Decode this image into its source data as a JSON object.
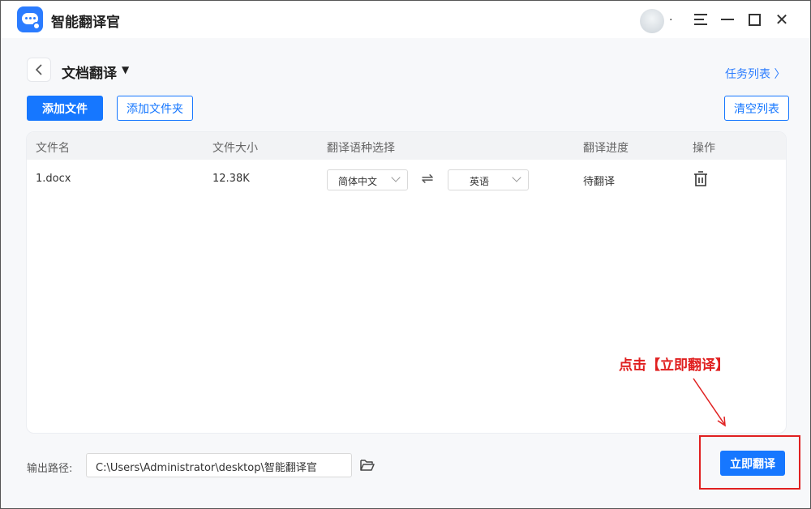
{
  "app": {
    "title": "智能翻译官",
    "avatar_suffix": ".",
    "window_controls": [
      "menu-icon",
      "minimize-icon",
      "maximize-icon",
      "close-icon"
    ]
  },
  "header": {
    "back_icon": "chevron-left-icon",
    "title": "文档翻译",
    "task_list_link": "任务列表 〉"
  },
  "toolbar": {
    "add_file": "添加文件",
    "add_folder": "添加文件夹",
    "clear_list": "清空列表"
  },
  "table": {
    "columns": [
      "文件名",
      "文件大小",
      "翻译语种选择",
      "翻译进度",
      "操作"
    ],
    "rows": [
      {
        "file_name": "1.docx",
        "file_size": "12.38K",
        "source_lang": "简体中文",
        "target_lang": "英语",
        "progress": "待翻译",
        "action_icon": "trash-icon"
      }
    ]
  },
  "footer": {
    "output_label": "输出路径:",
    "output_path": "C:\\Users\\Administrator\\desktop\\智能翻译官",
    "folder_icon": "folder-open-icon",
    "translate_button": "立即翻译"
  },
  "annotation": {
    "text": "点击【立即翻译】",
    "color": "#e02020"
  },
  "colors": {
    "accent": "#1677ff",
    "annotation": "#e02020"
  }
}
